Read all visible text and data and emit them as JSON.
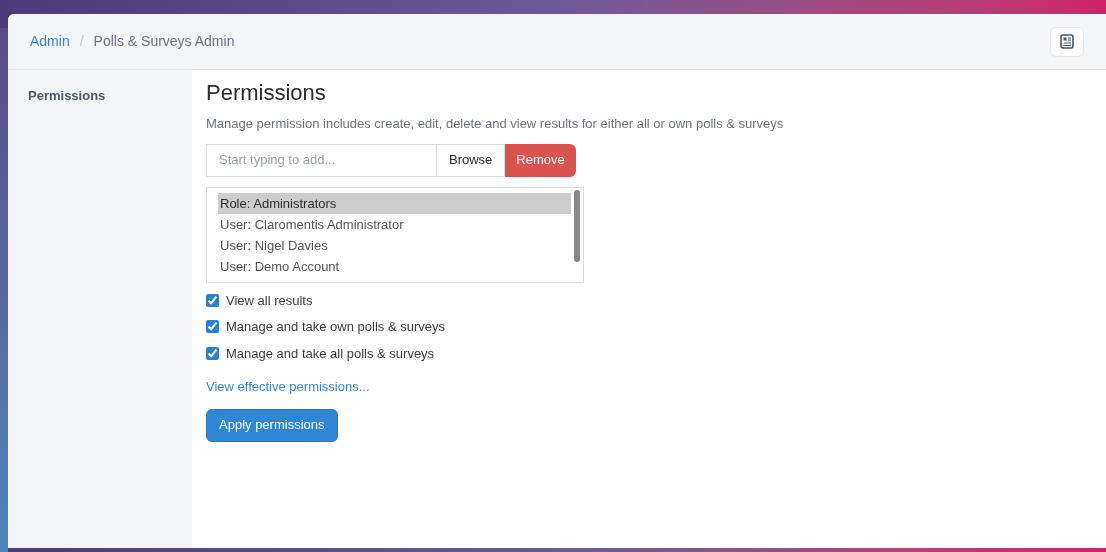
{
  "breadcrumb_separator": "/",
  "breadcrumb": [
    {
      "label": "Admin",
      "link": true
    },
    {
      "label": "Polls & Surveys Admin",
      "link": false
    }
  ],
  "sidebar": {
    "items": [
      {
        "label": "Permissions",
        "selected": true
      }
    ]
  },
  "main": {
    "title": "Permissions",
    "description": "Manage permission includes create, edit, delete and view results for either all or own polls & surveys",
    "search": {
      "placeholder": "Start typing to add..."
    },
    "buttons": [
      "Browse",
      "Remove"
    ],
    "principals": [
      {
        "label": "Role: Administrators",
        "selected": true
      },
      {
        "label": "User: Claromentis Administrator",
        "selected": false
      },
      {
        "label": "User: Nigel Davies",
        "selected": false
      },
      {
        "label": "User: Demo Account",
        "selected": false
      }
    ],
    "options": [
      {
        "label": "View all results",
        "checked": true
      },
      {
        "label": "Manage and take own polls & surveys",
        "checked": true
      },
      {
        "label": "Manage and take all polls & surveys",
        "checked": true
      }
    ],
    "link": "View effective permissions...",
    "apply_button": "Apply permissions"
  }
}
